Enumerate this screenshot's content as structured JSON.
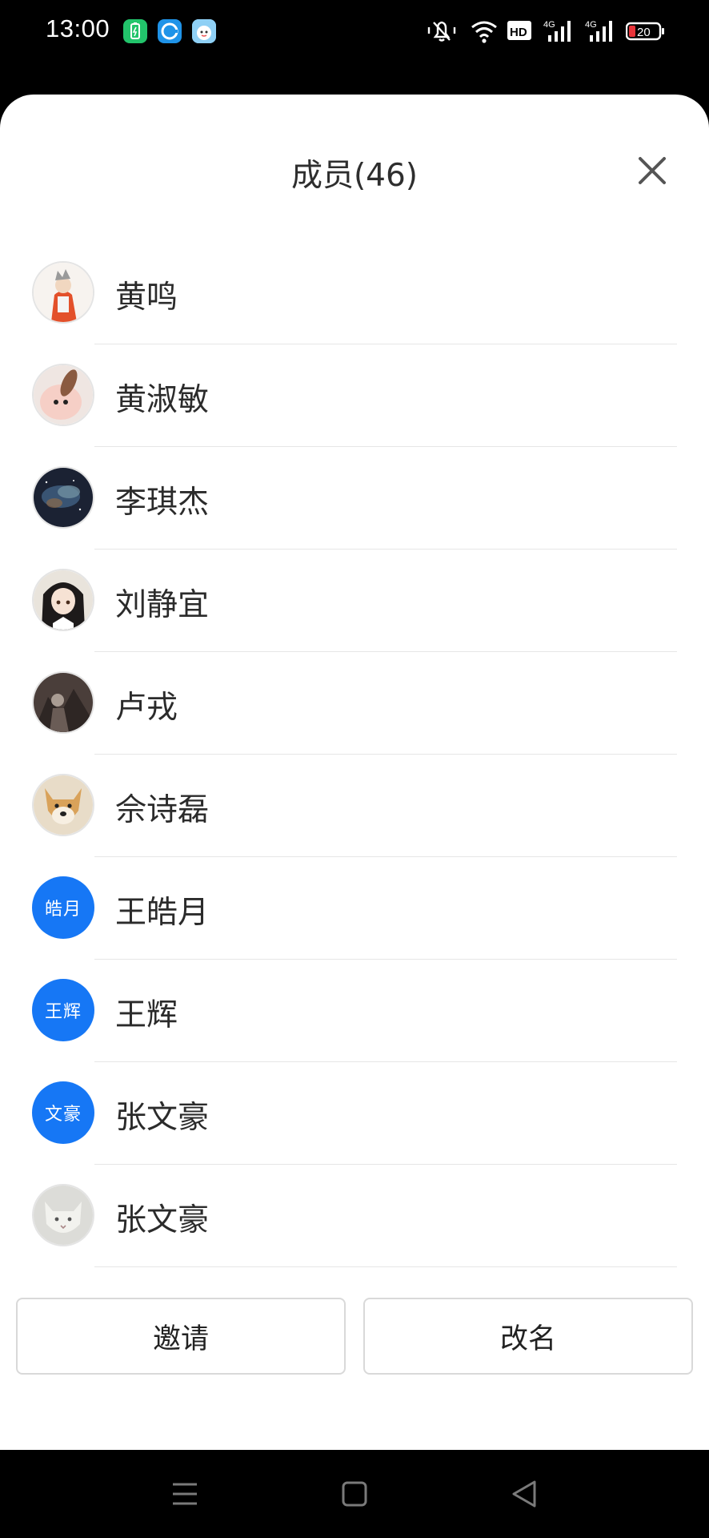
{
  "status_bar": {
    "time": "13:00",
    "hd_label": "HD",
    "network1": "4G",
    "network2": "4G",
    "battery_level": "20",
    "app_icons": [
      "battery-saver-app-icon",
      "edge-browser-app-icon",
      "cartoon-app-icon"
    ],
    "system_icons": [
      "mute-icon",
      "wifi-icon",
      "hd-icon",
      "signal-icon",
      "signal-icon",
      "battery-icon"
    ]
  },
  "sheet": {
    "title": "成员(46)",
    "close_icon": "close-icon"
  },
  "members": [
    {
      "name": "黄鸣",
      "avatar_type": "photo",
      "avatar_icon": "cartoon-character-avatar"
    },
    {
      "name": "黄淑敏",
      "avatar_type": "photo",
      "avatar_icon": "plush-toy-avatar"
    },
    {
      "name": "李琪杰",
      "avatar_type": "photo",
      "avatar_icon": "nebula-avatar"
    },
    {
      "name": "刘静宜",
      "avatar_type": "photo",
      "avatar_icon": "anime-girl-avatar"
    },
    {
      "name": "卢戎",
      "avatar_type": "photo",
      "avatar_icon": "dark-illustration-avatar"
    },
    {
      "name": "佘诗磊",
      "avatar_type": "photo",
      "avatar_icon": "shiba-dog-avatar"
    },
    {
      "name": "王皓月",
      "avatar_type": "text",
      "avatar_text": "皓月"
    },
    {
      "name": "王辉",
      "avatar_type": "text",
      "avatar_text": "王辉"
    },
    {
      "name": "张文豪",
      "avatar_type": "text",
      "avatar_text": "文豪"
    },
    {
      "name": "张文豪",
      "avatar_type": "photo",
      "avatar_icon": "cat-avatar"
    }
  ],
  "buttons": {
    "invite": "邀请",
    "rename": "改名"
  },
  "nav_bar": {
    "icons": [
      "menu-icon",
      "home-icon",
      "back-icon"
    ]
  },
  "colors": {
    "text_avatar_bg": "#1677f5",
    "divider": "#e6e6e6",
    "button_border": "#d9d9d9"
  }
}
